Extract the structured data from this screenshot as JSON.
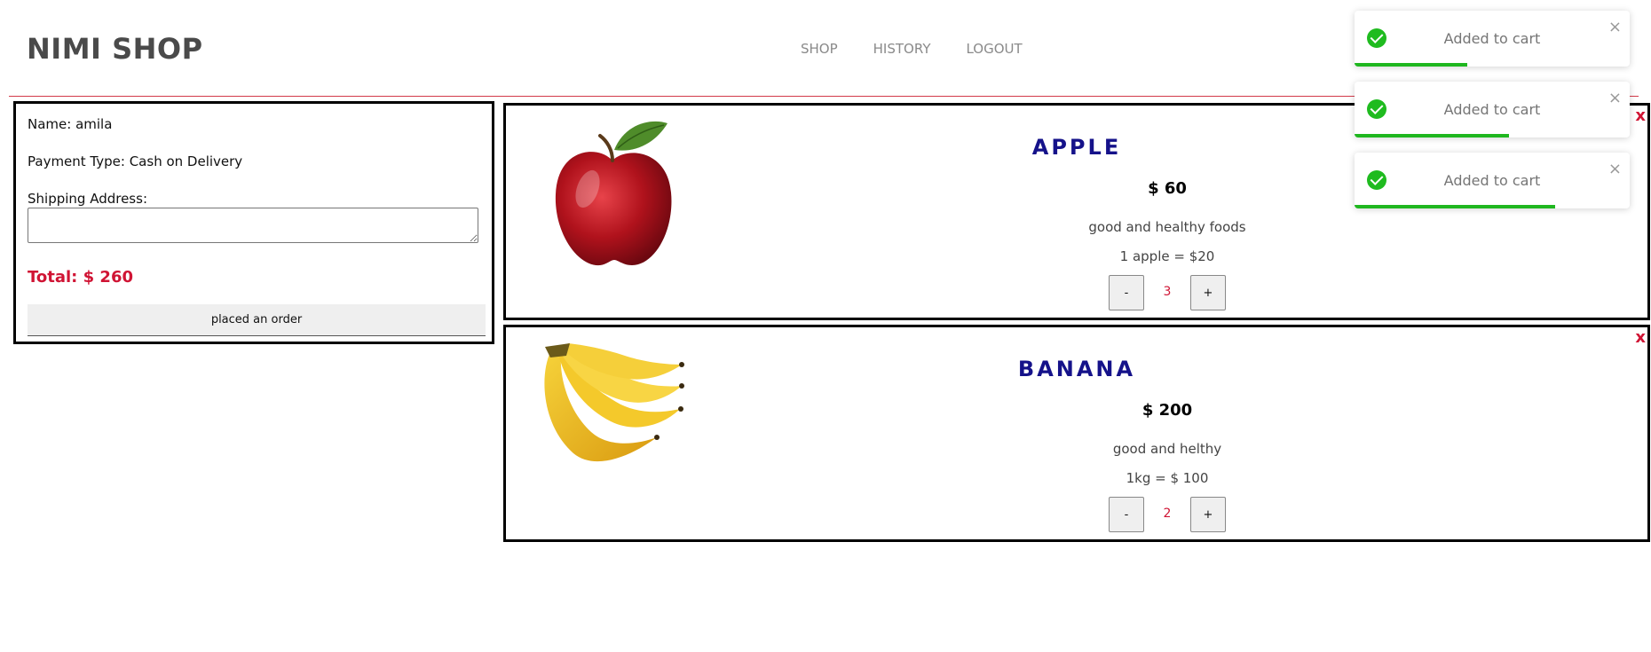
{
  "header": {
    "logo": "NIMI SHOP",
    "nav": [
      "SHOP",
      "HISTORY",
      "LOGOUT"
    ]
  },
  "checkout": {
    "name_line": "Name: amila",
    "payment_line": "Payment Type: Cash on Delivery",
    "address_label": "Shipping Address:",
    "address_value": "",
    "total": "Total: $ 260",
    "order_button": "placed an order"
  },
  "products": [
    {
      "name": "APPLE",
      "price": "$ 60",
      "description": "good and healthy foods",
      "unit": "1 apple = $20",
      "minus": "-",
      "plus": "+",
      "quantity": "3",
      "remove": "x",
      "image_icon": "apple-image"
    },
    {
      "name": "BANANA",
      "price": "$ 200",
      "description": "good and helthy",
      "unit": "1kg = $ 100",
      "minus": "-",
      "plus": "+",
      "quantity": "2",
      "remove": "x",
      "image_icon": "banana-image"
    }
  ],
  "toasts": [
    {
      "message": "Added to cart",
      "close": "×",
      "progress": 0.41
    },
    {
      "message": "Added to cart",
      "close": "×",
      "progress": 0.56
    },
    {
      "message": "Added to cart",
      "close": "×",
      "progress": 0.73
    }
  ],
  "colors": {
    "accent_red": "#d01434",
    "product_title": "#15128a",
    "toast_green": "#1fb71f"
  }
}
